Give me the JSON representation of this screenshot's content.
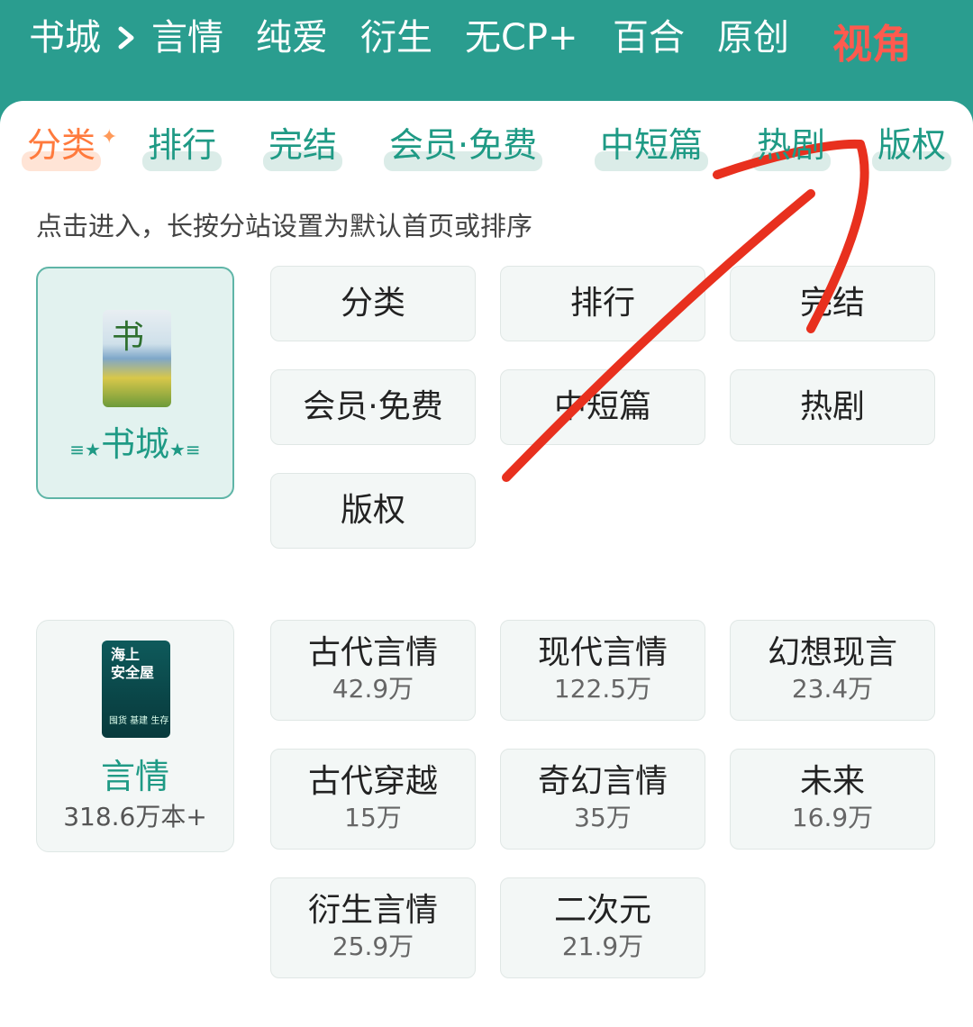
{
  "top_nav": {
    "items": [
      "书城",
      "言情",
      "纯爱",
      "衍生",
      "无CP+",
      "百合",
      "原创",
      "视角"
    ]
  },
  "icons": {
    "breadcrumb_chevron": "chevron-right-icon",
    "sparkle": "sparkle-icon"
  },
  "sub_tabs": [
    "分类",
    "排行",
    "完结",
    "会员·免费",
    "中短篇",
    "热剧",
    "版权"
  ],
  "hint": "点击进入，长按分站设置为默认首页或排序",
  "bookstore": {
    "title": "书城",
    "star_left": "≡★",
    "star_right": "★≡",
    "buttons": [
      "分类",
      "排行",
      "完结",
      "会员·免费",
      "中短篇",
      "热剧",
      "版权"
    ]
  },
  "romance": {
    "title": "言情",
    "count": "318.6万本+",
    "cover_text": "海上\n安全屋",
    "cover_footer": "囤货 基建 生存",
    "categories": [
      {
        "name": "古代言情",
        "count": "42.9万"
      },
      {
        "name": "现代言情",
        "count": "122.5万"
      },
      {
        "name": "幻想现言",
        "count": "23.4万"
      },
      {
        "name": "古代穿越",
        "count": "15万"
      },
      {
        "name": "奇幻言情",
        "count": "35万"
      },
      {
        "name": "未来",
        "count": "16.9万"
      },
      {
        "name": "衍生言情",
        "count": "25.9万"
      },
      {
        "name": "二次元",
        "count": "21.9万"
      }
    ]
  },
  "colors": {
    "header_bg": "#2a9d8f",
    "active_nav": "#ff5a4e",
    "active_tab": "#ff7a3d",
    "accent_green": "#1f9a85",
    "annotation_red": "#e8301e"
  }
}
